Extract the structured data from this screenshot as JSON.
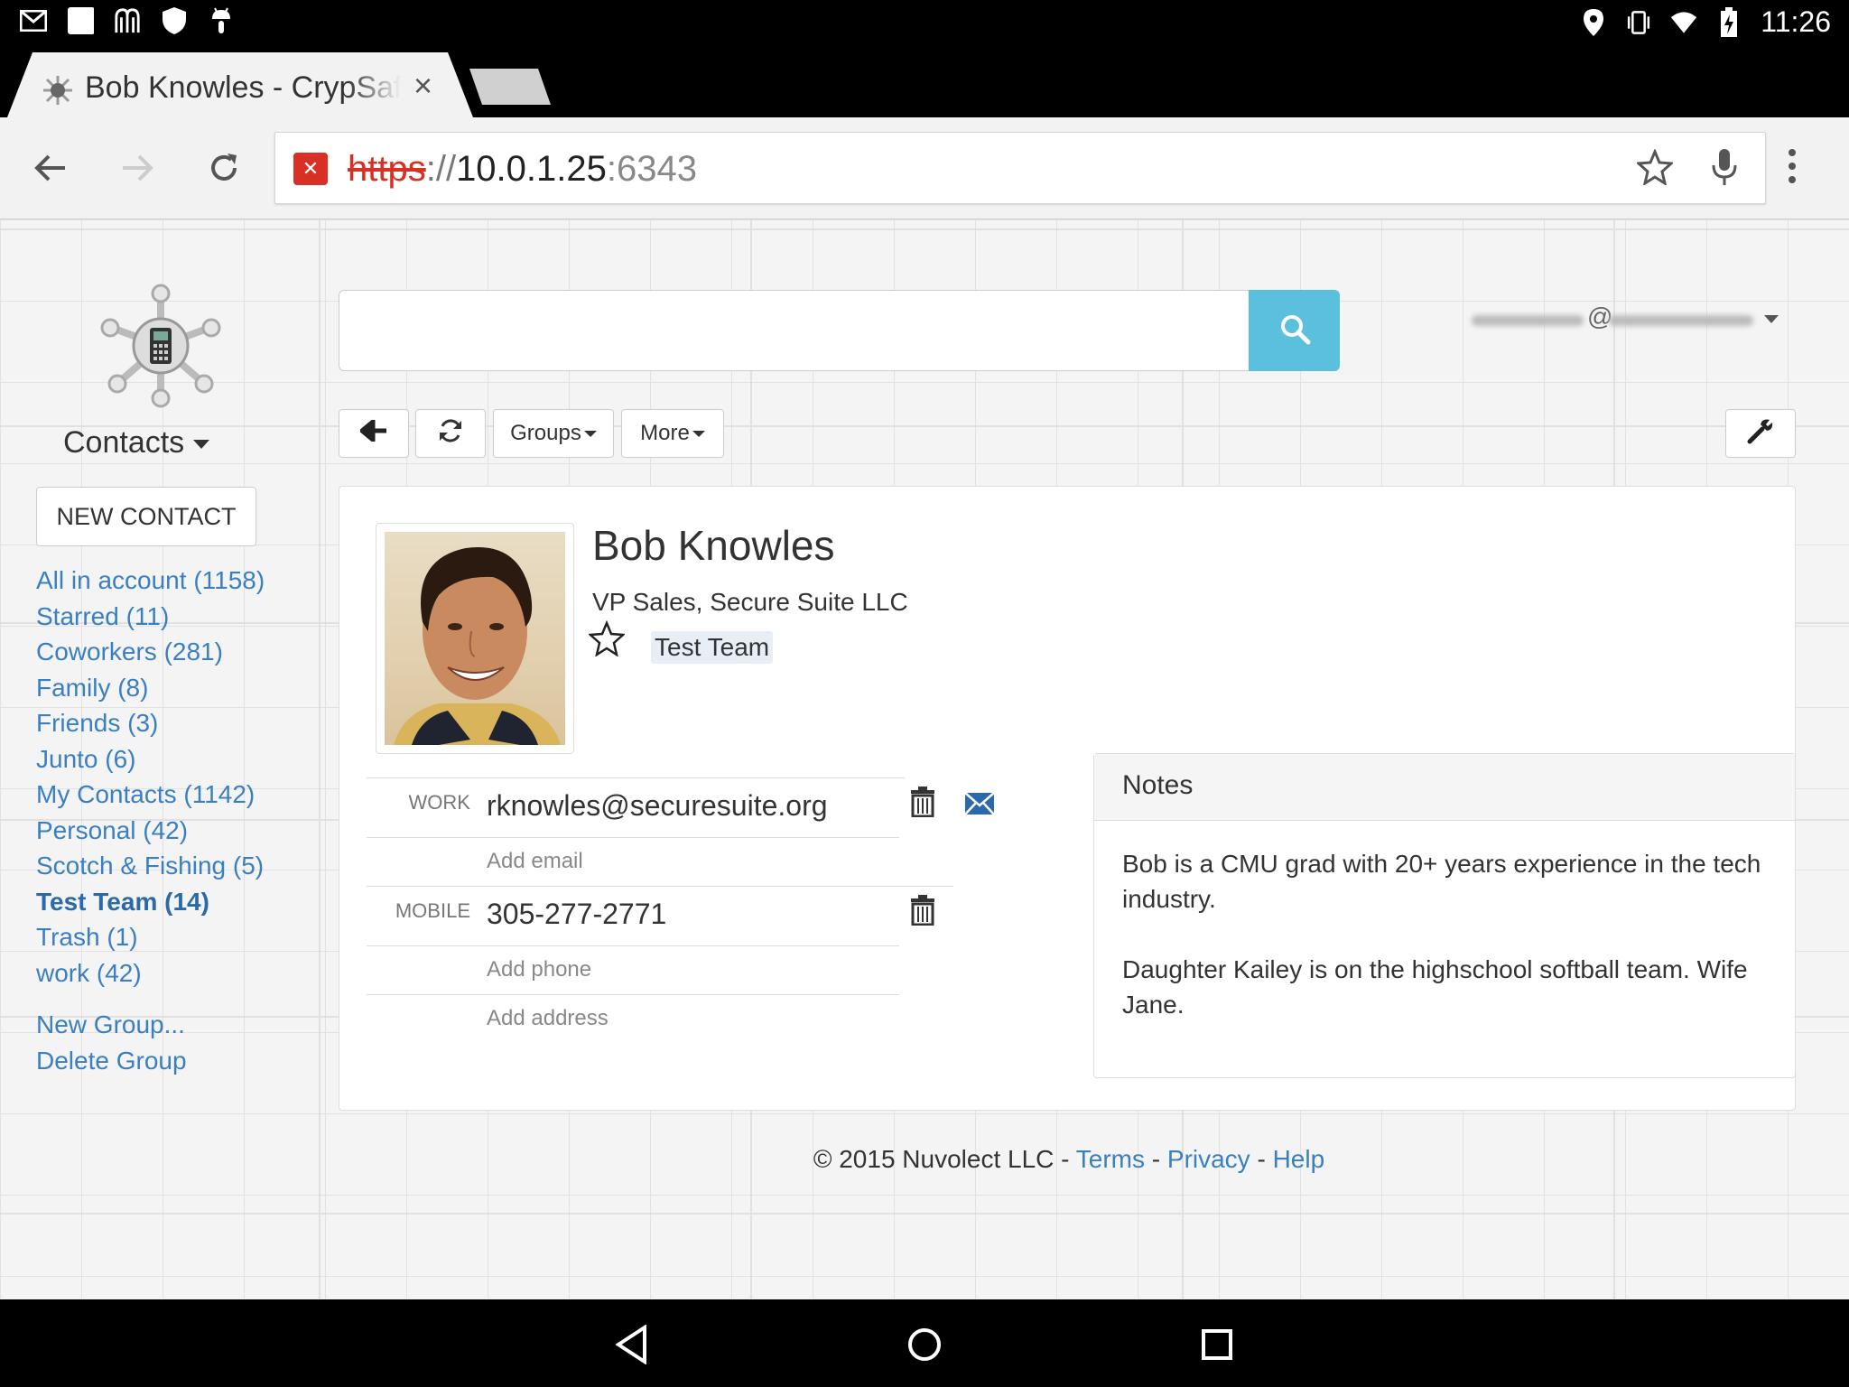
{
  "status_bar": {
    "time": "11:26",
    "left_icons": [
      "gmail-icon",
      "square-icon",
      "shopping-bag-icon",
      "shield-icon",
      "android-icon"
    ],
    "right_icons": [
      "location-icon",
      "vibrate-icon",
      "wifi-icon",
      "battery-charging-icon"
    ]
  },
  "browser": {
    "tab_title": "Bob Knowles - CrypSafe",
    "tab_close": "×",
    "url": {
      "scheme": "https",
      "separator": "://",
      "host": "10.0.1.25",
      "port": ":6343"
    }
  },
  "sidebar": {
    "title": "Contacts",
    "new_contact_label": "NEW CONTACT",
    "groups": [
      {
        "label": "All in account (1158)",
        "active": false
      },
      {
        "label": "Starred (11)",
        "active": false
      },
      {
        "label": "Coworkers (281)",
        "active": false
      },
      {
        "label": "Family (8)",
        "active": false
      },
      {
        "label": "Friends (3)",
        "active": false
      },
      {
        "label": "Junto (6)",
        "active": false
      },
      {
        "label": "My Contacts (1142)",
        "active": false
      },
      {
        "label": "Personal (42)",
        "active": false
      },
      {
        "label": "Scotch & Fishing (5)",
        "active": false
      },
      {
        "label": "Test Team (14)",
        "active": true
      },
      {
        "label": "Trash (1)",
        "active": false
      },
      {
        "label": "work (42)",
        "active": false
      }
    ],
    "actions": [
      "New Group...",
      "Delete Group"
    ]
  },
  "header": {
    "search_placeholder": "",
    "account_at": "@"
  },
  "action_bar": {
    "groups_label": "Groups",
    "more_label": "More"
  },
  "contact": {
    "name": "Bob Knowles",
    "title": "VP Sales, Secure Suite LLC",
    "group_tag": "Test Team",
    "email_label": "WORK",
    "email_value": "rknowles@securesuite.org",
    "add_email": "Add email",
    "phone_label": "MOBILE",
    "phone_value": "305-277-2771",
    "add_phone": "Add phone",
    "add_address": "Add address"
  },
  "notes": {
    "heading": "Notes",
    "paragraph_1": "Bob is a CMU grad with 20+ years experience in the tech industry.",
    "paragraph_2": "Daughter Kailey is on the highschool softball team.  Wife Jane."
  },
  "footer": {
    "copyright": "© 2015 Nuvolect LLC - ",
    "terms": "Terms",
    "sep1": " - ",
    "privacy": "Privacy",
    "sep2": " - ",
    "help": "Help"
  },
  "colors": {
    "link": "#3a7fc1",
    "search_button": "#5bc0de",
    "insecure_red": "#d93025"
  }
}
